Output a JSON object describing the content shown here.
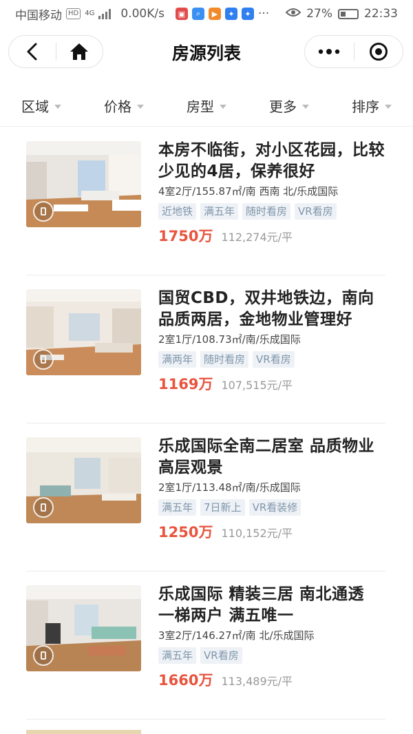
{
  "status_bar": {
    "carrier": "中国移动",
    "hd": "HD",
    "network": "4G",
    "speed": "0.00K/s",
    "more": "···",
    "battery_pct": "27%",
    "time": "22:33"
  },
  "nav": {
    "title": "房源列表"
  },
  "filters": [
    {
      "label": "区域"
    },
    {
      "label": "价格"
    },
    {
      "label": "房型"
    },
    {
      "label": "更多"
    },
    {
      "label": "排序"
    }
  ],
  "listings": [
    {
      "title": "本房不临街，对小区花园，比较少见的4居，保养很好",
      "meta": "4室2厅/155.87㎡/南 西南 北/乐成国际",
      "tags": [
        "近地铁",
        "满五年",
        "随时看房",
        "VR看房"
      ],
      "price": "1750万",
      "unit_price": "112,274元/平"
    },
    {
      "title": "国贸CBD，双井地铁边，南向品质两居，金地物业管理好",
      "meta": "2室1厅/108.73㎡/南/乐成国际",
      "tags": [
        "满两年",
        "随时看房",
        "VR看房"
      ],
      "price": "1169万",
      "unit_price": "107,515元/平"
    },
    {
      "title": "乐成国际全南二居室 品质物业 高层观景",
      "meta": "2室1厅/113.48㎡/南/乐成国际",
      "tags": [
        "满五年",
        "7日新上",
        "VR看装修"
      ],
      "price": "1250万",
      "unit_price": "110,152元/平"
    },
    {
      "title": "乐成国际 精装三居 南北通透 一梯两户 满五唯一",
      "meta": "3室2厅/146.27㎡/南 北/乐成国际",
      "tags": [
        "满五年",
        "VR看房"
      ],
      "price": "1660万",
      "unit_price": "113,489元/平"
    }
  ]
}
